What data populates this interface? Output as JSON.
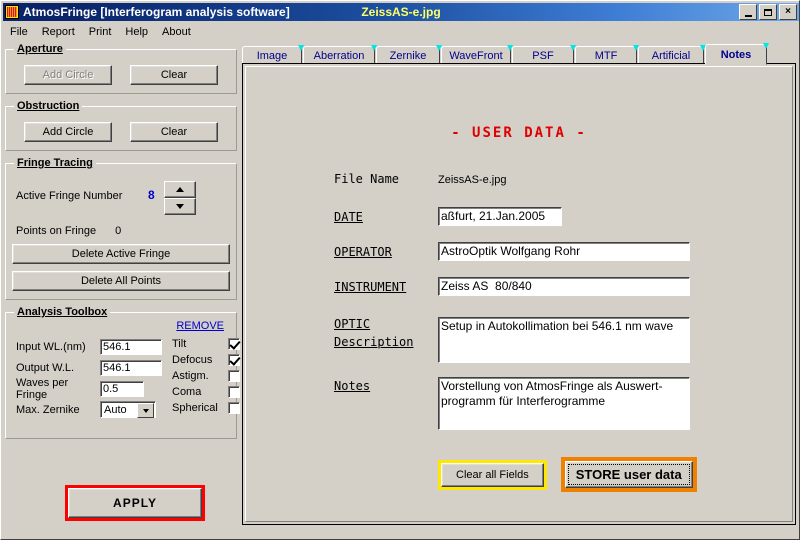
{
  "window": {
    "app_title": "AtmosFringe  [Interferogram analysis software]",
    "document_title": "ZeissAS-e.jpg",
    "icon": "interferogram-icon",
    "controls": {
      "minimize": "minimize-icon",
      "maximize": "maximize-icon",
      "close": "×"
    }
  },
  "menu": {
    "items": [
      "File",
      "Report",
      "Print",
      "Help",
      "About"
    ]
  },
  "left_panel": {
    "aperture": {
      "legend": "Aperture",
      "add_circle_label": "Add Circle",
      "clear_label": "Clear",
      "add_circle_enabled": false
    },
    "obstruction": {
      "legend": "Obstruction",
      "add_circle_label": "Add Circle",
      "clear_label": "Clear"
    },
    "fringe_tracing": {
      "legend": "Fringe Tracing",
      "active_fringe_label": "Active Fringe Number",
      "active_fringe_value": "8",
      "spinner_minus": "-",
      "spinner_plus": "+",
      "points_label": "Points on  Fringe",
      "points_value": "0",
      "delete_active_label": "Delete Active Fringe",
      "delete_all_label": "Delete  All  Points"
    },
    "analysis_toolbox": {
      "legend": "Analysis Toolbox",
      "remove_label": "REMOVE",
      "remove_color": "#0000cc",
      "fields": [
        {
          "label": "Input WL.(nm)",
          "value": "546.1"
        },
        {
          "label": "Output W.L.",
          "value": "546.1"
        },
        {
          "label": "Waves per Fringe",
          "value": "0.5"
        }
      ],
      "zernike_label": "Max. Zernike",
      "zernike_value": "Auto",
      "checkboxes": [
        {
          "label": "Tilt",
          "checked": true
        },
        {
          "label": "Defocus",
          "checked": true
        },
        {
          "label": "Astigm.",
          "checked": false
        },
        {
          "label": "Coma",
          "checked": false
        },
        {
          "label": "Spherical",
          "checked": false
        }
      ]
    },
    "apply_label": "APPLY",
    "apply_border_color": "#ff0000"
  },
  "tabs": [
    {
      "label": "Image",
      "active": false
    },
    {
      "label": "Aberration",
      "active": false
    },
    {
      "label": "Zernike",
      "active": false
    },
    {
      "label": "WaveFront",
      "active": false
    },
    {
      "label": "PSF",
      "active": false
    },
    {
      "label": "MTF",
      "active": false
    },
    {
      "label": "Artificial",
      "active": false
    },
    {
      "label": "Notes",
      "active": true
    }
  ],
  "notes_page": {
    "heading": "-  USER   DATA  -",
    "heading_color": "#e00000",
    "file_name_label": "File Name",
    "file_name_value": "ZeissAS-e.jpg",
    "date_label": "DATE",
    "date_value": "aßfurt, 21.Jan.2005",
    "operator_label": "OPERATOR",
    "operator_value": "AstroOptik Wolfgang Rohr",
    "instrument_label": "INSTRUMENT",
    "instrument_value": "Zeiss AS  80/840",
    "optic_label_line1": "OPTIC",
    "optic_label_line2": "Description",
    "optic_value": "Setup in Autokollimation bei 546.1 nm wave",
    "notes_label": "Notes",
    "notes_value": "Vorstellung von AtmosFringe als Auswert-programm für Interferogramme",
    "clear_button_label": "Clear all Fields",
    "clear_button_border": "#ffe800",
    "store_button_label": "STORE  user data",
    "store_button_border": "#f08000"
  }
}
